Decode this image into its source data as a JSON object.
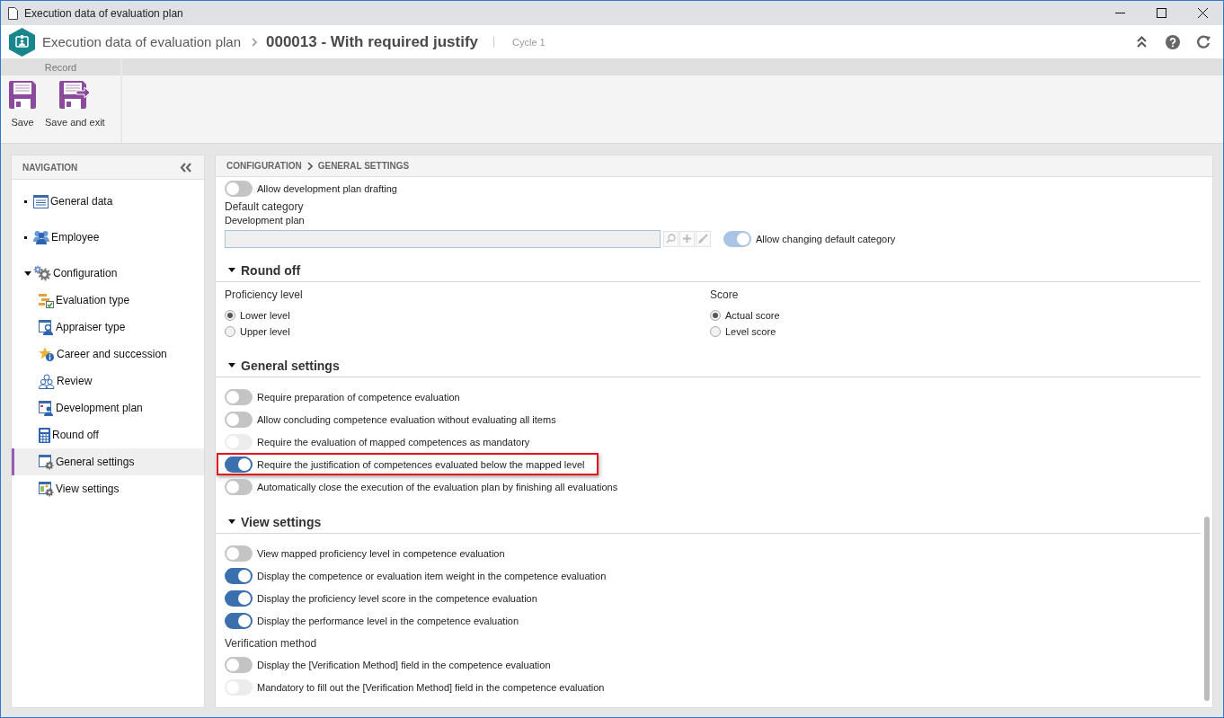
{
  "window": {
    "title": "Execution data of evaluation plan"
  },
  "header": {
    "module": "Execution data of evaluation plan",
    "record": "000013 - With required justify",
    "cycle": "Cycle 1"
  },
  "ribbon": {
    "group": "Record",
    "buttons": [
      {
        "label": "Save",
        "kind": "save"
      },
      {
        "label": "Save and exit",
        "kind": "save_exit"
      }
    ]
  },
  "navigation": {
    "title": "NAVIGATION",
    "items": [
      {
        "label": "General data",
        "selected": false
      },
      {
        "label": "Employee",
        "selected": false
      },
      {
        "label": "Configuration",
        "selected": false,
        "expanded": true,
        "children": [
          {
            "label": "Evaluation type",
            "selected": false
          },
          {
            "label": "Appraiser type",
            "selected": false
          },
          {
            "label": "Career and succession",
            "selected": false
          },
          {
            "label": "Review",
            "selected": false
          },
          {
            "label": "Development plan",
            "selected": false
          },
          {
            "label": "Round off",
            "selected": false
          },
          {
            "label": "General settings",
            "selected": true
          },
          {
            "label": "View settings",
            "selected": false
          }
        ]
      }
    ]
  },
  "content": {
    "breadcrumb": [
      "CONFIGURATION",
      "GENERAL SETTINGS"
    ],
    "top_toggles": [
      {
        "label": "Allow development plan drafting",
        "on": false,
        "disabled": false
      }
    ],
    "default_category": {
      "title": "Default category",
      "field_label": "Development plan",
      "toggle": {
        "label": "Allow changing default category",
        "on": true,
        "disabled": true
      }
    },
    "sections": [
      {
        "title": "Round off",
        "expanded": true,
        "kind": "radios",
        "groups": [
          {
            "title": "Proficiency level",
            "options": [
              {
                "label": "Lower level",
                "selected": true
              },
              {
                "label": "Upper level",
                "selected": false
              }
            ]
          },
          {
            "title": "Score",
            "options": [
              {
                "label": "Actual score",
                "selected": true
              },
              {
                "label": "Level score",
                "selected": false
              }
            ]
          }
        ]
      },
      {
        "title": "General settings",
        "expanded": true,
        "kind": "toggles",
        "blocks": [
          {
            "toggles": [
              {
                "label": "Require preparation of competence evaluation",
                "on": false,
                "disabled": false,
                "highlighted": false
              },
              {
                "label": "Allow concluding competence evaluation without evaluating all items",
                "on": false,
                "disabled": false,
                "highlighted": false
              },
              {
                "label": "Require the evaluation of mapped competences as mandatory",
                "on": false,
                "disabled": true,
                "highlighted": false
              },
              {
                "label": "Require the justification of competences evaluated below the mapped level",
                "on": true,
                "disabled": false,
                "highlighted": true
              },
              {
                "label": "Automatically close the execution of the evaluation plan by finishing all evaluations",
                "on": false,
                "disabled": false,
                "highlighted": false
              }
            ]
          }
        ]
      },
      {
        "title": "View settings",
        "expanded": true,
        "kind": "toggles",
        "blocks": [
          {
            "toggles": [
              {
                "label": "View mapped proficiency level in competence evaluation",
                "on": false,
                "disabled": false
              },
              {
                "label": "Display the competence or evaluation item weight in the competence evaluation",
                "on": true,
                "disabled": false
              },
              {
                "label": "Display the proficiency level score in the competence evaluation",
                "on": true,
                "disabled": false
              },
              {
                "label": "Display the performance level in the competence evaluation",
                "on": true,
                "disabled": false
              }
            ]
          },
          {
            "title": "Verification method",
            "toggles": [
              {
                "label": "Display the [Verification Method] field in the competence evaluation",
                "on": false,
                "disabled": false
              },
              {
                "label": "Mandatory to fill out the [Verification Method] field in the competence evaluation",
                "on": false,
                "disabled": true
              }
            ]
          }
        ]
      }
    ]
  }
}
